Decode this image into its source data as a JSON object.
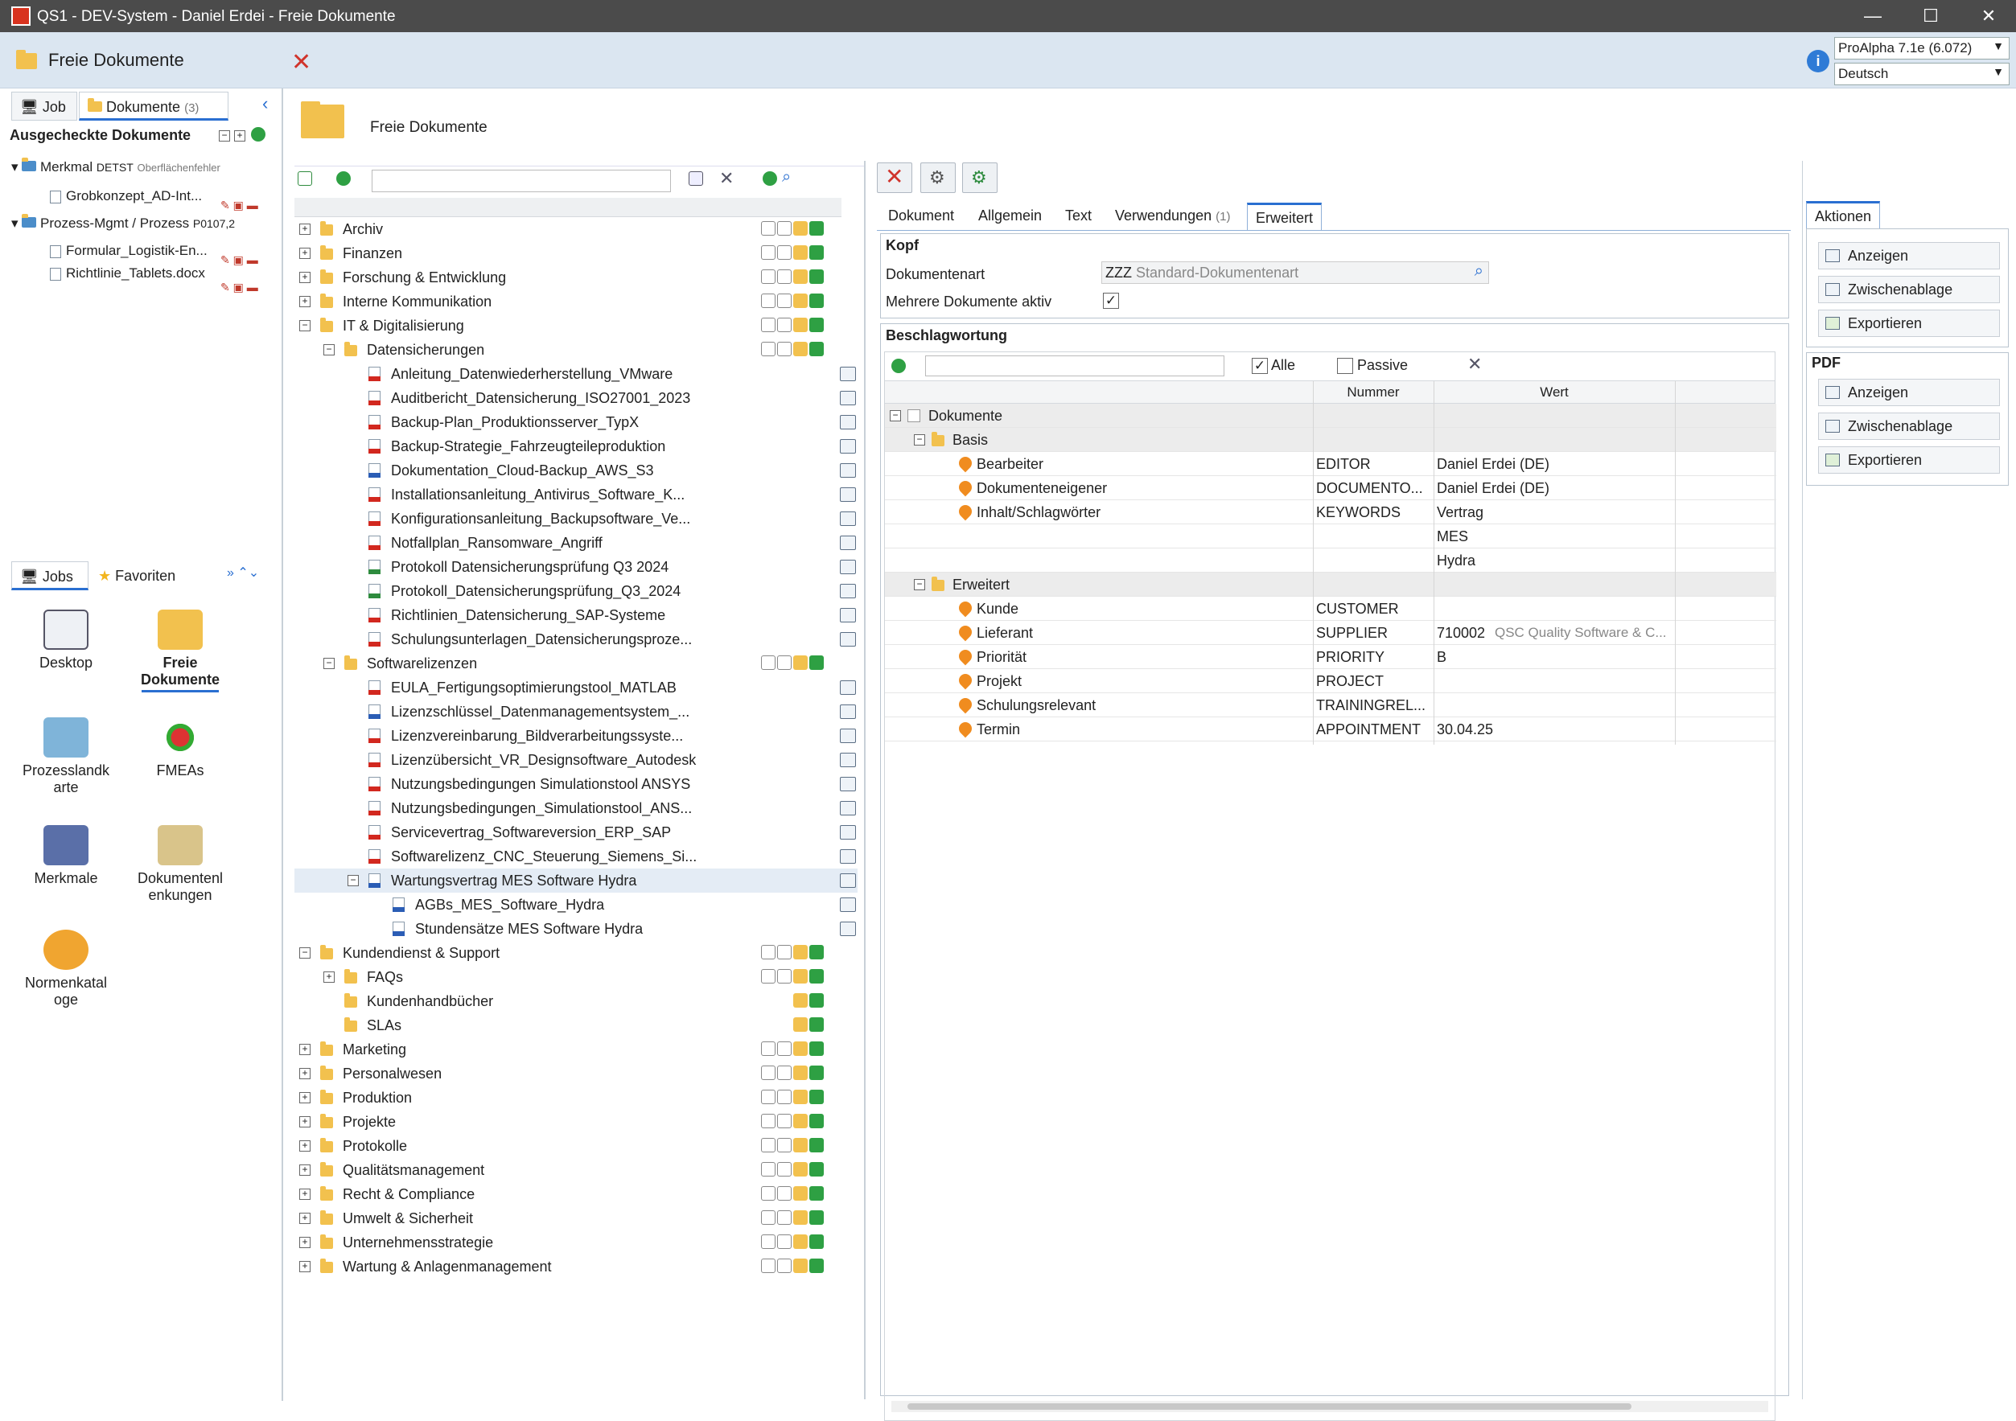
{
  "window": {
    "title": "QS1 - DEV-System - Daniel Erdei - Freie Dokumente",
    "min": "—",
    "max": "☐",
    "close": "✕"
  },
  "header": {
    "title": "Freie Dokumente",
    "version": "ProAlpha 7.1e (6.072)",
    "language": "Deutsch",
    "info": "i"
  },
  "left": {
    "tabs": [
      {
        "label": "Job"
      },
      {
        "label": "Dokumente",
        "count": "(3)"
      }
    ],
    "section_title": "Ausgecheckte Dokumente",
    "items": [
      {
        "label": "Merkmal",
        "code": "DETST",
        "extra": "Oberflächenfehler"
      },
      {
        "label": "Grobkonzept_AD-Int..."
      },
      {
        "label": "Prozess-Mgmt / Prozess",
        "code": "P0107,2"
      },
      {
        "label": "Formular_Logistik-En..."
      },
      {
        "label": "Richtlinie_Tablets.docx"
      }
    ],
    "bottom_tabs": [
      {
        "label": "Jobs"
      },
      {
        "label": "Favoriten"
      }
    ],
    "jobs": [
      {
        "label": "Desktop"
      },
      {
        "label": "Freie Dokumente"
      },
      {
        "label": "Prozesslandk arte"
      },
      {
        "label": "FMEAs"
      },
      {
        "label": "Merkmale"
      },
      {
        "label": "Dokumentenl enkungen"
      },
      {
        "label": "Normenkatal oge"
      }
    ]
  },
  "center": {
    "heading": "Freie Dokumente",
    "search_placeholder": "",
    "tree": [
      {
        "label": "Archiv",
        "type": "folder",
        "level": 0,
        "exp": "+"
      },
      {
        "label": "Finanzen",
        "type": "folder",
        "level": 0,
        "exp": "+"
      },
      {
        "label": "Forschung & Entwicklung",
        "type": "folder",
        "level": 0,
        "exp": "+"
      },
      {
        "label": "Interne Kommunikation",
        "type": "folder",
        "level": 0,
        "exp": "+"
      },
      {
        "label": "IT & Digitalisierung",
        "type": "folder",
        "level": 0,
        "exp": "−"
      },
      {
        "label": "Datensicherungen",
        "type": "folder",
        "level": 1,
        "exp": "−"
      },
      {
        "label": "Anleitung_Datenwiederherstellung_VMware",
        "type": "pdf",
        "level": 2
      },
      {
        "label": "Auditbericht_Datensicherung_ISO27001_2023",
        "type": "pdf",
        "level": 2
      },
      {
        "label": "Backup-Plan_Produktionsserver_TypX",
        "type": "pdf",
        "level": 2
      },
      {
        "label": "Backup-Strategie_Fahrzeugteileproduktion",
        "type": "pdf",
        "level": 2
      },
      {
        "label": "Dokumentation_Cloud-Backup_AWS_S3",
        "type": "word",
        "level": 2
      },
      {
        "label": "Installationsanleitung_Antivirus_Software_K...",
        "type": "pdf",
        "level": 2
      },
      {
        "label": "Konfigurationsanleitung_Backupsoftware_Ve...",
        "type": "pdf",
        "level": 2
      },
      {
        "label": "Notfallplan_Ransomware_Angriff",
        "type": "pdf",
        "level": 2
      },
      {
        "label": "Protokoll Datensicherungsprüfung Q3 2024",
        "type": "xls",
        "level": 2
      },
      {
        "label": "Protokoll_Datensicherungsprüfung_Q3_2024",
        "type": "xls",
        "level": 2
      },
      {
        "label": "Richtlinien_Datensicherung_SAP-Systeme",
        "type": "pdf",
        "level": 2
      },
      {
        "label": "Schulungsunterlagen_Datensicherungsproze...",
        "type": "pdf",
        "level": 2
      },
      {
        "label": "Softwarelizenzen",
        "type": "folder",
        "level": 1,
        "exp": "−"
      },
      {
        "label": "EULA_Fertigungsoptimierungstool_MATLAB",
        "type": "pdf",
        "level": 2
      },
      {
        "label": "Lizenzschlüssel_Datenmanagementsystem_...",
        "type": "word",
        "level": 2
      },
      {
        "label": "Lizenzvereinbarung_Bildverarbeitungssyste...",
        "type": "pdf",
        "level": 2
      },
      {
        "label": "Lizenzübersicht_VR_Designsoftware_Autodesk",
        "type": "pdf",
        "level": 2
      },
      {
        "label": "Nutzungsbedingungen Simulationstool ANSYS",
        "type": "pdf",
        "level": 2
      },
      {
        "label": "Nutzungsbedingungen_Simulationstool_ANS...",
        "type": "pdf",
        "level": 2
      },
      {
        "label": "Servicevertrag_Softwareversion_ERP_SAP",
        "type": "pdf",
        "level": 2
      },
      {
        "label": "Softwarelizenz_CNC_Steuerung_Siemens_Si...",
        "type": "pdf",
        "level": 2
      },
      {
        "label": "Wartungsvertrag MES Software Hydra",
        "type": "word",
        "level": 2,
        "exp": "−",
        "selected": true
      },
      {
        "label": "AGBs_MES_Software_Hydra",
        "type": "word",
        "level": 3
      },
      {
        "label": "Stundensätze MES Software Hydra",
        "type": "word",
        "level": 3
      },
      {
        "label": "Kundendienst & Support",
        "type": "folder",
        "level": 0,
        "exp": "−"
      },
      {
        "label": "FAQs",
        "type": "folder",
        "level": 1,
        "exp": "+"
      },
      {
        "label": "Kundenhandbücher",
        "type": "folder",
        "level": 1
      },
      {
        "label": "SLAs",
        "type": "folder",
        "level": 1
      },
      {
        "label": "Marketing",
        "type": "folder",
        "level": 0,
        "exp": "+"
      },
      {
        "label": "Personalwesen",
        "type": "folder",
        "level": 0,
        "exp": "+"
      },
      {
        "label": "Produktion",
        "type": "folder",
        "level": 0,
        "exp": "+"
      },
      {
        "label": "Projekte",
        "type": "folder",
        "level": 0,
        "exp": "+"
      },
      {
        "label": "Protokolle",
        "type": "folder",
        "level": 0,
        "exp": "+"
      },
      {
        "label": "Qualitätsmanagement",
        "type": "folder",
        "level": 0,
        "exp": "+"
      },
      {
        "label": "Recht & Compliance",
        "type": "folder",
        "level": 0,
        "exp": "+"
      },
      {
        "label": "Umwelt & Sicherheit",
        "type": "folder",
        "level": 0,
        "exp": "+"
      },
      {
        "label": "Unternehmensstrategie",
        "type": "folder",
        "level": 0,
        "exp": "+"
      },
      {
        "label": "Wartung & Anlagenmanagement",
        "type": "folder",
        "level": 0,
        "exp": "+"
      }
    ]
  },
  "detail": {
    "tabs": [
      {
        "label": "Dokument"
      },
      {
        "label": "Allgemein"
      },
      {
        "label": "Text"
      },
      {
        "label": "Verwendungen",
        "count": "(1)"
      },
      {
        "label": "Erweitert"
      }
    ],
    "kopf": {
      "title": "Kopf",
      "doctype_label": "Dokumentenart",
      "doctype_code": "ZZZ",
      "doctype_name": "Standard-Dokumentenart",
      "multi_label": "Mehrere Dokumente aktiv",
      "multi_checked": "✓"
    },
    "beschlag": {
      "title": "Beschlagwortung",
      "all_label": "Alle",
      "all_checked": "✓",
      "passive_label": "Passive",
      "col_nummer": "Nummer",
      "col_wert": "Wert",
      "rows": [
        {
          "label": "Dokumente",
          "kind": "root",
          "level": 0
        },
        {
          "label": "Basis",
          "kind": "folder",
          "level": 1
        },
        {
          "label": "Bearbeiter",
          "kind": "pin",
          "level": 2,
          "nummer": "EDITOR",
          "wert": "Daniel Erdei (DE)",
          "extra": ""
        },
        {
          "label": "Dokumenteneigener",
          "kind": "pin",
          "level": 2,
          "nummer": "DOCUMENTO...",
          "wert": "Daniel Erdei (DE)",
          "extra": ""
        },
        {
          "label": "Inhalt/Schlagwörter",
          "kind": "pin",
          "level": 2,
          "nummer": "KEYWORDS",
          "wert": "Vertrag",
          "extra": ""
        },
        {
          "label": "",
          "kind": "blank",
          "level": 2,
          "nummer": "",
          "wert": "MES",
          "extra": ""
        },
        {
          "label": "",
          "kind": "blank",
          "level": 2,
          "nummer": "",
          "wert": "Hydra",
          "extra": ""
        },
        {
          "label": "Erweitert",
          "kind": "folder",
          "level": 1
        },
        {
          "label": "Kunde",
          "kind": "pin",
          "level": 2,
          "nummer": "CUSTOMER",
          "wert": "",
          "extra": ""
        },
        {
          "label": "Lieferant",
          "kind": "pin",
          "level": 2,
          "nummer": "SUPPLIER",
          "wert": "710002",
          "extra": "QSC Quality Software & C..."
        },
        {
          "label": "Priorität",
          "kind": "pin",
          "level": 2,
          "nummer": "PRIORITY",
          "wert": "B",
          "extra": ""
        },
        {
          "label": "Projekt",
          "kind": "pin",
          "level": 2,
          "nummer": "PROJECT",
          "wert": "",
          "extra": ""
        },
        {
          "label": "Schulungsrelevant",
          "kind": "pin",
          "level": 2,
          "nummer": "TRAININGREL...",
          "wert": "",
          "extra": ""
        },
        {
          "label": "Termin",
          "kind": "pin",
          "level": 2,
          "nummer": "APPOINTMENT",
          "wert": "30.04.25",
          "extra": ""
        }
      ]
    }
  },
  "aktionen": {
    "tab": "Aktionen",
    "buttons": [
      "Anzeigen",
      "Zwischenablage",
      "Exportieren"
    ],
    "pdf_title": "PDF",
    "pdf_buttons": [
      "Anzeigen",
      "Zwischenablage",
      "Exportieren"
    ]
  },
  "colors": {
    "titlebar": "#4b4b4b",
    "header": "#dbe6f1",
    "folder": "#f2c14e",
    "accent": "#2a6fd1",
    "pin": "#f08c1f",
    "close_red": "#d0342c"
  }
}
